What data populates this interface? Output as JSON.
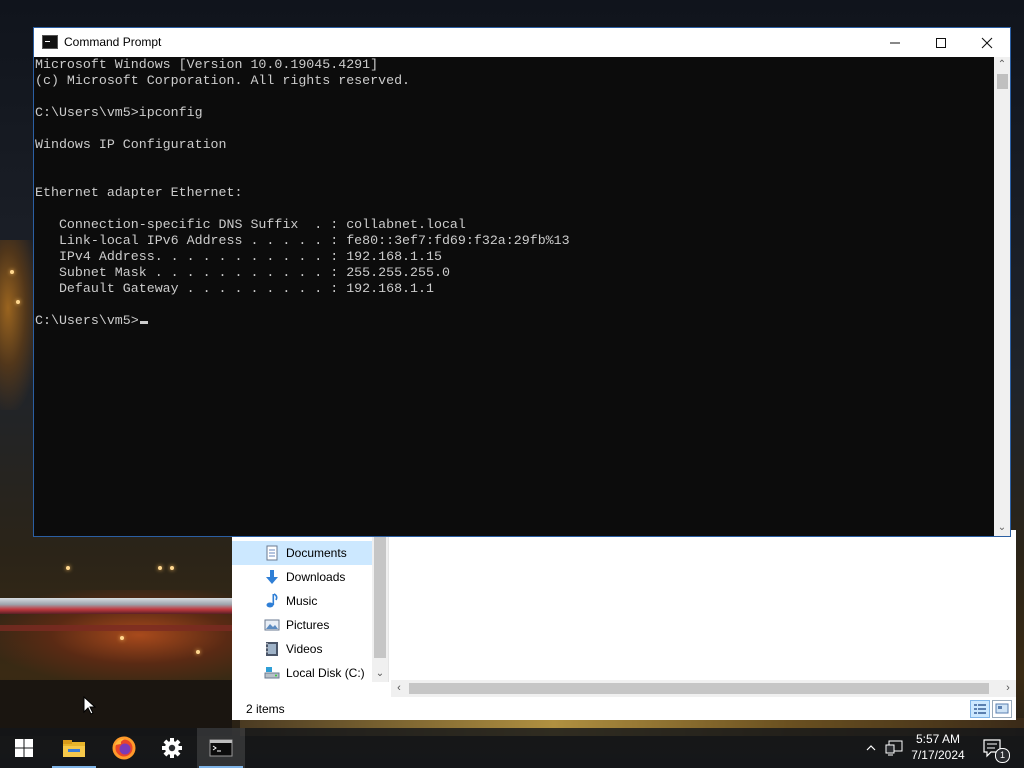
{
  "cmd_window": {
    "title": "Command Prompt",
    "minimize_glyph": "—",
    "maximize_glyph": "☐",
    "close_glyph": "✕",
    "console_text": "Microsoft Windows [Version 10.0.19045.4291]\n(c) Microsoft Corporation. All rights reserved.\n\nC:\\Users\\vm5>ipconfig\n\nWindows IP Configuration\n\n\nEthernet adapter Ethernet:\n\n   Connection-specific DNS Suffix  . : collabnet.local\n   Link-local IPv6 Address . . . . . : fe80::3ef7:fd69:f32a:29fb%13\n   IPv4 Address. . . . . . . . . . . : 192.168.1.15\n   Subnet Mask . . . . . . . . . . . : 255.255.255.0\n   Default Gateway . . . . . . . . . : 192.168.1.1\n\n",
    "prompt": "C:\\Users\\vm5>"
  },
  "explorer": {
    "nav_items": [
      {
        "label": "Documents",
        "icon": "documents-icon",
        "selected": true
      },
      {
        "label": "Downloads",
        "icon": "downloads-icon"
      },
      {
        "label": "Music",
        "icon": "music-icon"
      },
      {
        "label": "Pictures",
        "icon": "pictures-icon"
      },
      {
        "label": "Videos",
        "icon": "videos-icon"
      },
      {
        "label": "Local Disk (C:)",
        "icon": "local-disk-icon"
      }
    ],
    "status_text": "2 items"
  },
  "taskbar": {
    "apps": [
      "start-icon",
      "file-explorer-icon",
      "firefox-icon",
      "settings-icon",
      "command-prompt-icon"
    ],
    "clock_time": "5:57 AM",
    "clock_date": "7/17/2024",
    "notification_count": "1"
  },
  "colors": {
    "console_bg": "#0c0c0c",
    "console_fg": "#cccccc",
    "selection": "#cce8ff",
    "window_border": "#2b5fa3"
  }
}
